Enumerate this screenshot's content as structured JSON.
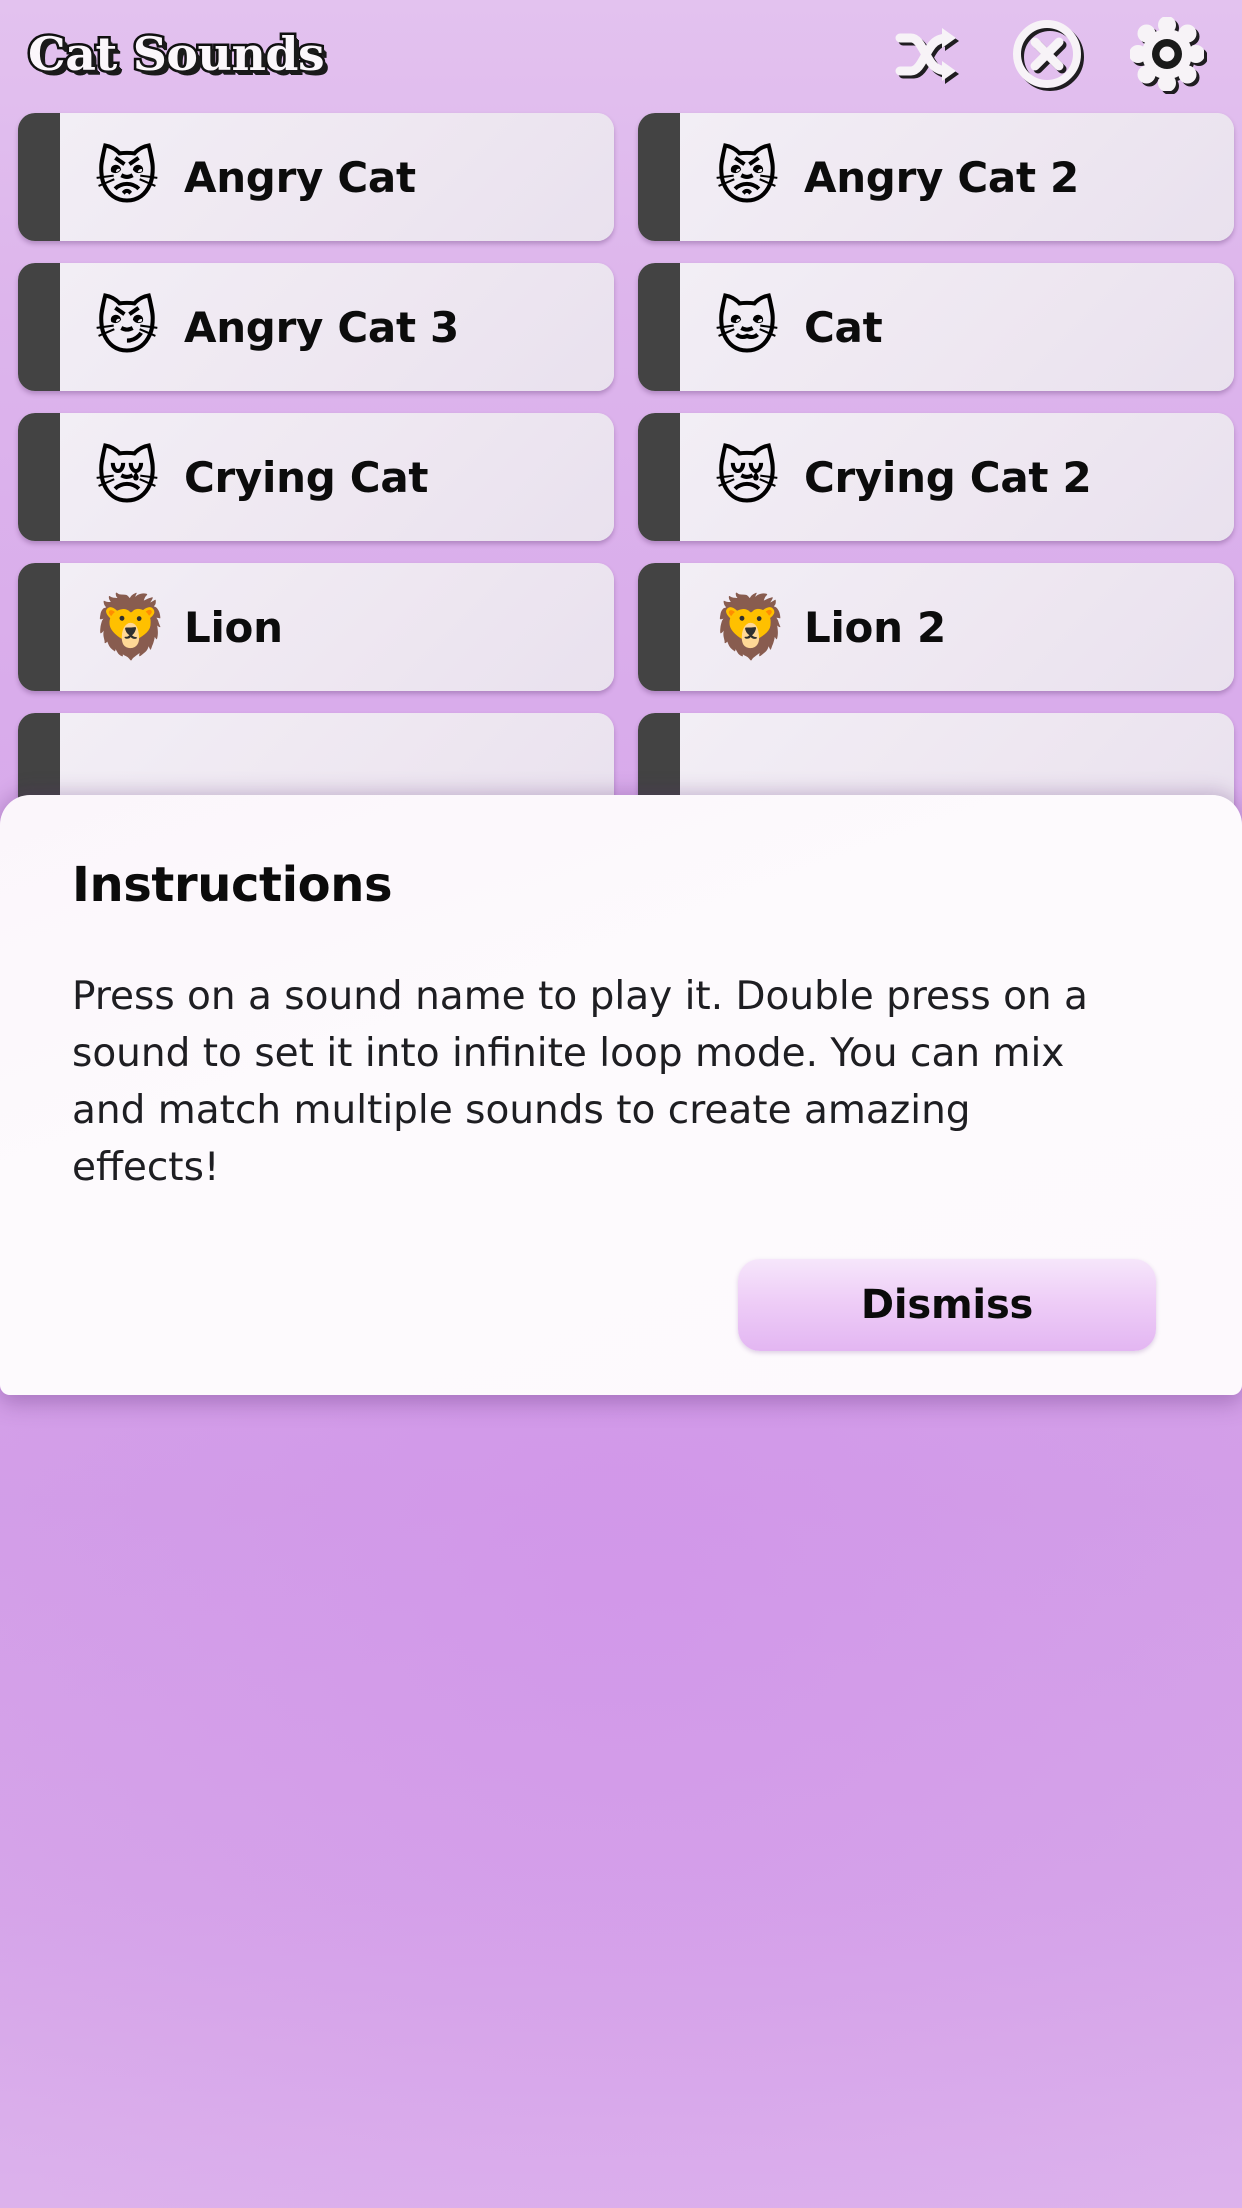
{
  "header": {
    "title": "Cat Sounds",
    "actions": [
      {
        "name": "shuffle-icon",
        "label": "Shuffle"
      },
      {
        "name": "stop-icon",
        "label": "Stop All"
      },
      {
        "name": "gear-icon",
        "label": "Settings"
      }
    ]
  },
  "sounds": [
    {
      "label": "Angry Cat",
      "emoji": "😾",
      "accent": "#434343"
    },
    {
      "label": "Angry Cat 2",
      "emoji": "😾",
      "accent": "#434343"
    },
    {
      "label": "Angry Cat 3",
      "emoji": "😼",
      "accent": "#434343"
    },
    {
      "label": "Cat",
      "emoji": "🐱",
      "accent": "#434343"
    },
    {
      "label": "Crying Cat",
      "emoji": "😿",
      "accent": "#434343"
    },
    {
      "label": "Crying Cat 2",
      "emoji": "😿",
      "accent": "#434343"
    },
    {
      "label": "Lion",
      "emoji": "🦁",
      "accent": "#434343"
    },
    {
      "label": "Lion 2",
      "emoji": "🦁",
      "accent": "#434343"
    },
    {
      "label": "",
      "emoji": "",
      "accent": "#434343"
    },
    {
      "label": "",
      "emoji": "",
      "accent": "#434343"
    }
  ],
  "modal": {
    "title": "Instructions",
    "body": "Press on a sound name to play it. Double press on a sound to set it into infinite loop mode. You can mix and match multiple sounds to create amazing effects!",
    "dismiss_label": "Dismiss"
  },
  "colors": {
    "background_top": "#e3c2ef",
    "background_mid": "#d3a0e8",
    "card_surface": "#efe9f2",
    "card_accent": "#434343",
    "modal_surface": "#fdfafd",
    "dismiss_gradient_top": "#f6e6fb",
    "dismiss_gradient_bottom": "#e3b6f2",
    "title_fill": "#fbf7fb",
    "title_outline": "#101010"
  }
}
